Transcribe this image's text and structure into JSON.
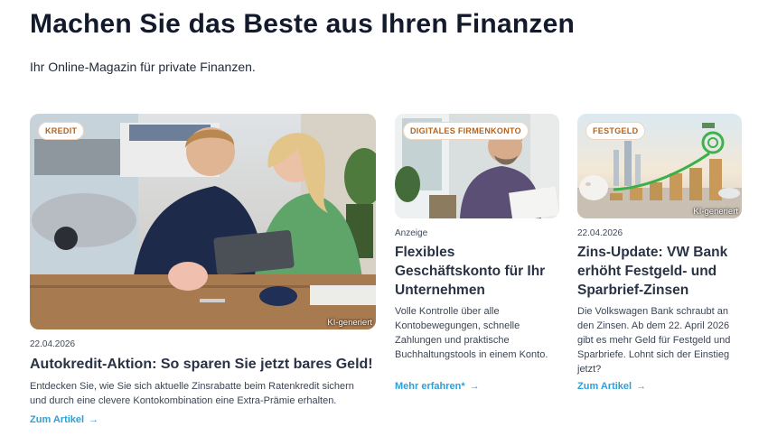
{
  "header": {
    "title": "Machen Sie das Beste aus Ihren Finanzen",
    "subtitle": "Ihr Online-Magazin für private Finanzen."
  },
  "cards": [
    {
      "badge": "KREDIT",
      "image_note": "KI-generiert",
      "meta": "22.04.2026",
      "title": "Autokredit-Aktion: So sparen Sie jetzt bares Geld!",
      "text": "Entdecken Sie, wie Sie sich aktuelle Zinsrabatte beim Ratenkredit sichern und durch eine clevere Kontokombination eine Extra-Prämie erhalten.",
      "cta": "Zum Artikel"
    },
    {
      "badge": "DIGITALES FIRMENKONTO",
      "image_note": "",
      "meta": "Anzeige",
      "title": "Flexibles Geschäftskonto für Ihr Unternehmen",
      "text": "Volle Kontrolle über alle Kontobewegungen, schnelle Zahlungen und praktische Buchhaltungstools in einem Konto.",
      "cta": "Mehr erfahren*"
    },
    {
      "badge": "FESTGELD",
      "image_note": "KI-generiert",
      "meta": "22.04.2026",
      "title": "Zins-Update: VW Bank erhöht Festgeld- und Sparbrief-Zinsen",
      "text": "Die Volkswagen Bank schraubt an den Zinsen. Ab dem 22. April 2026 gibt es mehr Geld für Festgeld und Sparbriefe. Lohnt sich der Einstieg jetzt?",
      "cta": "Zum Artikel"
    }
  ],
  "colors": {
    "accent_link": "#2f9fd8",
    "badge_text": "#b3631e",
    "title_text": "#121a2b"
  },
  "icons": {
    "cta_arrow": "arrow-right-icon"
  }
}
